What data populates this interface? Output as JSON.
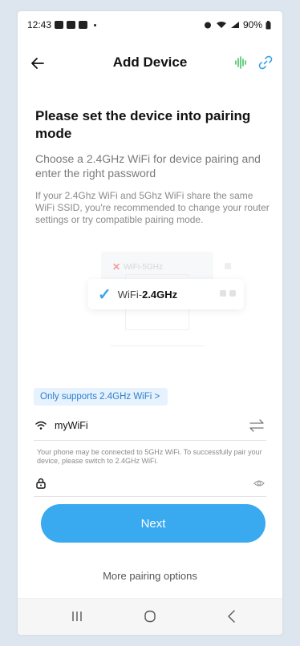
{
  "status_bar": {
    "time": "12:43",
    "battery": "90%"
  },
  "header": {
    "title": "Add Device",
    "accent_color": "#3ba4ec",
    "sound_color": "#45c46b"
  },
  "content": {
    "heading": "Please set the device into pairing mode",
    "subheading": "Choose a 2.4GHz WiFi for device pairing and enter the right password",
    "notice": "If your 2.4Ghz WiFi and 5Ghz WiFi share the same WiFi SSID, you're recommended to change your router settings or try compatible pairing mode."
  },
  "illustration": {
    "wifi_5ghz_label": "WiFi-5GHz",
    "wifi_24_prefix": "WiFi-",
    "wifi_24_band": "2.4GHz"
  },
  "form": {
    "support_pill_label": "Only supports 2.4GHz WiFi >",
    "ssid_value": "myWiFi",
    "hint": "Your phone may be connected to 5GHz WiFi. To successfully pair your device, please switch to 2.4GHz WiFi.",
    "password_value": "",
    "password_placeholder": ""
  },
  "actions": {
    "next_label": "Next",
    "more_options_label": "More pairing options",
    "button_color": "#39a9f0"
  }
}
